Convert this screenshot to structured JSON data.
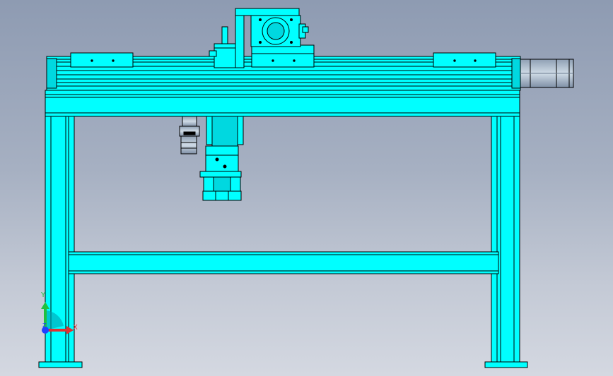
{
  "viewport": {
    "background_top": "#8e9bb2",
    "background_bottom": "#d4d8e1",
    "model_color": "#00ffff",
    "model_shade": "#00d8e0",
    "edge_color": "#000000",
    "motor_color": "#b4c4d4"
  },
  "triad": {
    "x_label": "X",
    "y_label": "Y",
    "z_label": "Z",
    "x_color": "#e03030",
    "y_color": "#20c040",
    "z_color": "#2040ff"
  }
}
